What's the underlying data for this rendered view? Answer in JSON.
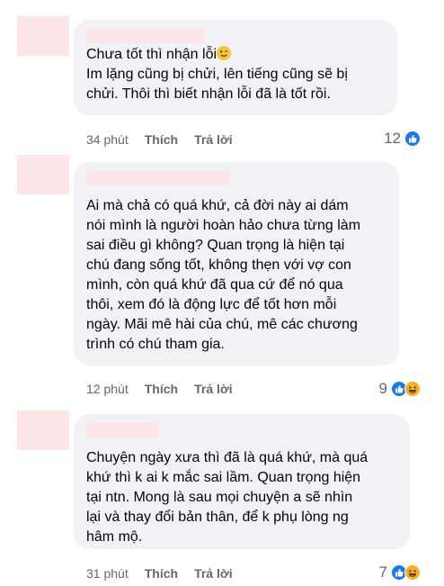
{
  "comments": [
    {
      "heading": "Chưa tốt thì nhận lỗi",
      "text": "Im lặng cũng bị chửi, lên tiếng cũng sẽ bị\nchửi. Thôi thì biết nhận lỗi đã là tốt rồi.",
      "time": "34 phút",
      "like": "Thích",
      "reply": "Trả lời",
      "reaction_count": "12",
      "reactions": [
        "like-icon"
      ]
    },
    {
      "text": "Ai mà chả có quá khứ, cả đời này ai dám\nnói mình là người hoàn hảo chưa từng làm\nsai điều gì không? Quan trọng là hiện tại\nchú đang sống tốt, không thẹn với vợ con\nmình, còn quá khứ đã qua cứ để nó qua\nthôi, xem đó là động lực để tốt hơn mỗi\nngày. Mãi mê hài của chú, mê các chương\ntrình có chú tham gia.",
      "time": "12 phút",
      "like": "Thích",
      "reply": "Trả lời",
      "reaction_count": "9",
      "reactions": [
        "like-icon",
        "haha-icon"
      ]
    },
    {
      "text": "Chuyện ngày xưa thì đã là quá khứ, mà quá\nkhứ thì k ai k mắc sai lầm. Quan trọng hiện\ntại ntn. Mong là sau mọi chuyện a sẽ nhìn\nlại và thay đổi bản thân, để k phụ lòng ng\nhâm mộ.",
      "time": "31 phút",
      "like": "Thích",
      "reply": "Trả lời",
      "reaction_count": "7",
      "reactions": [
        "like-icon",
        "haha-icon"
      ]
    }
  ],
  "colors": {
    "bubble": "#f0f2f5",
    "like_blue": "#1877f2",
    "haha_yellow": "#f7b125",
    "meta_gray": "#65676b",
    "redaction_pink": "#fde6e8"
  }
}
